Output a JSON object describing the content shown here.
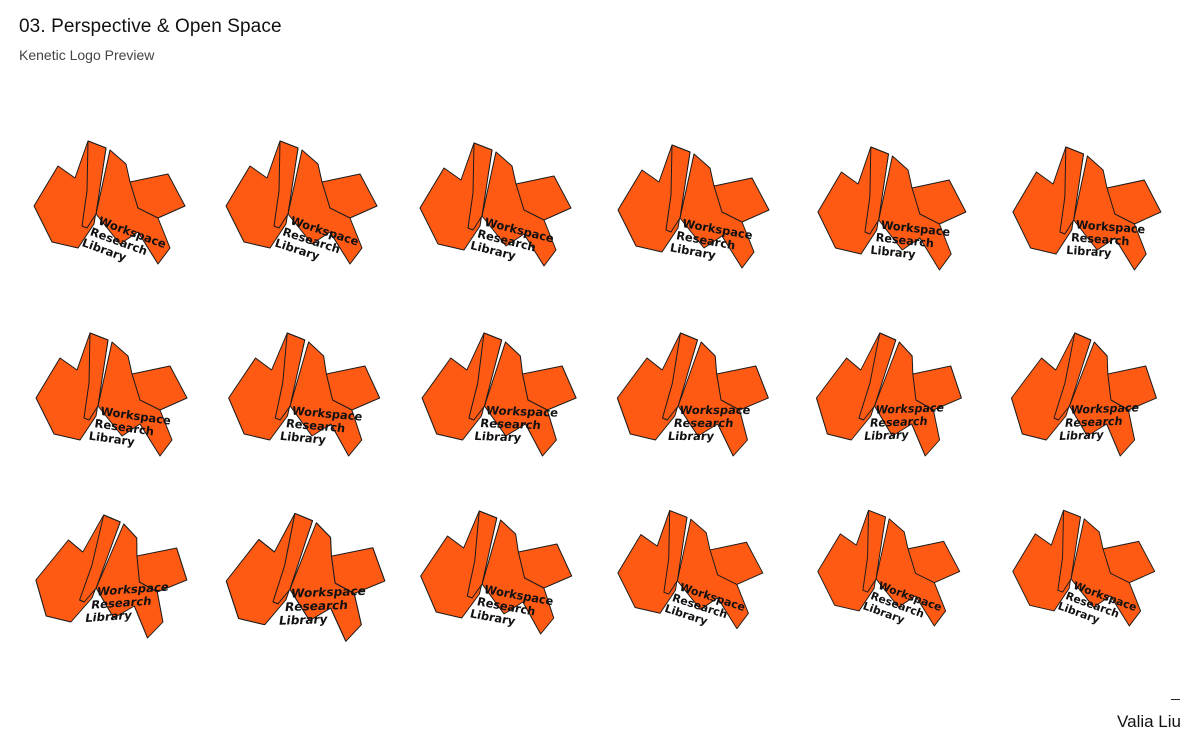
{
  "header": {
    "title": "03. Perspective & Open Space",
    "subtitle": "Kenetic Logo Preview"
  },
  "logo": {
    "line1": "Workspace",
    "line2": "Research",
    "line3": "Library",
    "fill_color": "#FF5A14",
    "stroke_color": "#1A1A1A"
  },
  "footer": {
    "author": "Valia Liu"
  }
}
